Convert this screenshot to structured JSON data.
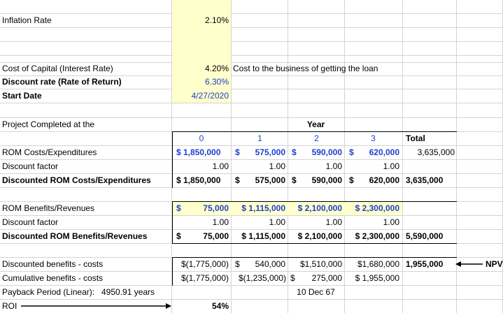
{
  "inflation": {
    "label": "Inflation Rate",
    "value": "2.10%"
  },
  "cost_capital": {
    "label": "Cost of Capital (Interest Rate)",
    "value": "4.20%",
    "note": "Cost to the business of getting the loan"
  },
  "discount_rate": {
    "label": "Discount rate (Rate of Return)",
    "value": "6.30%"
  },
  "start_date": {
    "label": "Start Date",
    "value": "4/27/2020"
  },
  "project_completed": {
    "label": "Project Completed at the",
    "year_header": "Year"
  },
  "years": [
    "0",
    "1",
    "2",
    "3"
  ],
  "total_label": "Total",
  "rom_costs": {
    "label": "ROM Costs/Expenditures",
    "cells": [
      "$ 1,850,000",
      "$",
      "575,000",
      "$",
      "590,000",
      "$",
      "620,000"
    ],
    "total": "3,635,000"
  },
  "discount_factor_1": {
    "label": "Discount factor",
    "values": [
      "1.00",
      "1.00",
      "1.00",
      "1.00"
    ]
  },
  "discounted_costs": {
    "label": "Discounted ROM Costs/Expenditures",
    "cells": [
      "$ 1,850,000",
      "$",
      "575,000",
      "$",
      "590,000",
      "$",
      "620,000"
    ],
    "total": "3,635,000"
  },
  "rom_benefits": {
    "label": "ROM Benefits/Revenues",
    "cells": [
      "$",
      "75,000",
      "$ 1,115,000",
      "$ 2,100,000",
      "$ 2,300,000"
    ]
  },
  "discount_factor_2": {
    "label": "Discount factor",
    "values": [
      "1.00",
      "1.00",
      "1.00",
      "1.00"
    ]
  },
  "discounted_benefits": {
    "label": "Discounted ROM Benefits/Revenues",
    "cells": [
      "$",
      "75,000",
      "$ 1,115,000",
      "$ 2,100,000",
      "$ 2,300,000"
    ],
    "total": "5,590,000"
  },
  "disc_benefits_costs": {
    "label": "Discounted benefits - costs",
    "cells": [
      "$(1,775,000)",
      "$",
      "540,000",
      "$1,510,000",
      "$1,680,000"
    ],
    "total": "1,955,000",
    "npv": "NPV"
  },
  "cumulative": {
    "label": "Cumulative benefits - costs",
    "cells": [
      "$(1,775,000)",
      "$(1,235,000)",
      "$",
      "275,000",
      "$ 1,955,000"
    ]
  },
  "payback": {
    "label": "Payback Period (Linear):",
    "value": "4950.91 years",
    "date": "10 Dec 67"
  },
  "roi": {
    "label": "ROI",
    "value": "54%"
  }
}
